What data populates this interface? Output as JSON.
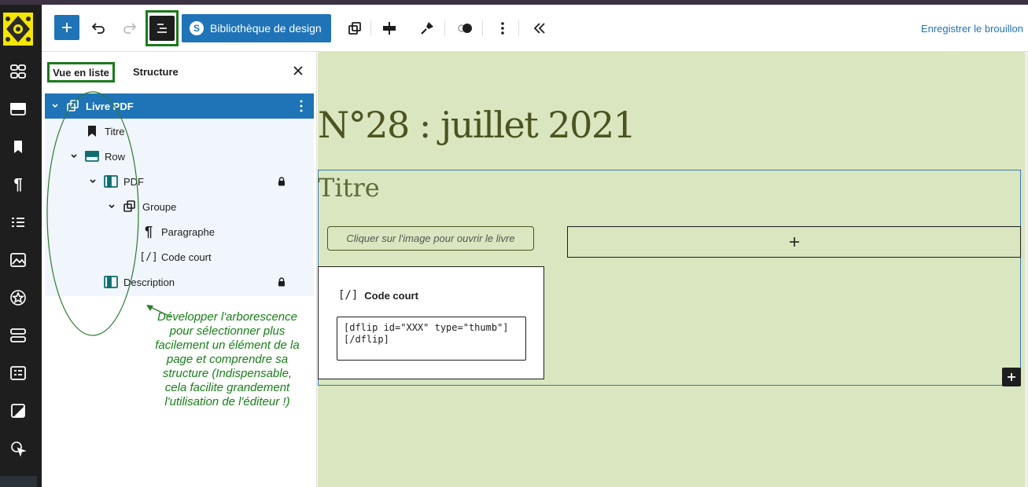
{
  "admin_menu": {
    "items": [
      "logo-icon",
      "layout-icon",
      "block-icon",
      "bookmark-icon",
      "pilcrow-icon",
      "list-icon",
      "image-icon",
      "star-icon",
      "stack-icon",
      "form-icon",
      "media-icon",
      "cursor-icon"
    ]
  },
  "toolbar": {
    "design_library_label": "Bibliothèque de design",
    "design_library_badge": "S",
    "save_draft_label": "Enregistrer le brouillon"
  },
  "panel": {
    "tabs": [
      {
        "label": "Vue en liste",
        "active": true
      },
      {
        "label": "Structure",
        "active": false
      }
    ],
    "tree": [
      {
        "label": "Livre PDF",
        "level": 0,
        "expanded": true,
        "selected": true,
        "locked": false,
        "icon": "group-icon"
      },
      {
        "label": "Titre",
        "level": 1,
        "expanded": null,
        "selected": false,
        "locked": false,
        "icon": "bookmark-icon"
      },
      {
        "label": "Row",
        "level": 1,
        "expanded": true,
        "selected": false,
        "locked": false,
        "icon": "row-icon"
      },
      {
        "label": "PDF",
        "level": 2,
        "expanded": true,
        "selected": false,
        "locked": true,
        "icon": "column-icon"
      },
      {
        "label": "Groupe",
        "level": 3,
        "expanded": true,
        "selected": false,
        "locked": false,
        "icon": "group-icon"
      },
      {
        "label": "Paragraphe",
        "level": 4,
        "expanded": null,
        "selected": false,
        "locked": false,
        "icon": "pilcrow-icon"
      },
      {
        "label": "Code court",
        "level": 4,
        "expanded": null,
        "selected": false,
        "locked": false,
        "icon": "shortcode-icon"
      },
      {
        "label": "Description",
        "level": 2,
        "expanded": null,
        "selected": false,
        "locked": true,
        "icon": "column-icon"
      }
    ]
  },
  "annotation": {
    "text": "Développer l'arborescence pour sélectionner plus facilement un élément de la page et comprendre sa structure (Indispensable, cela facilite grandement l'utilisation de l'éditeur !)"
  },
  "canvas": {
    "heading": "N°28 : juillet 2021",
    "title": "Titre",
    "pill_text": "Cliquer sur l'image pour ouvrir le livre",
    "shortcode_icon": "[/]",
    "shortcode_label": "Code court",
    "shortcode_value": "[dflip id=\"XXX\" type=\"thumb\"]\n[/dflip]"
  },
  "colors": {
    "accent": "#1f73b7",
    "canvas_bg": "#d9e6bf",
    "annotation_green": "#1b7f1b",
    "heading_olive": "#4b5320"
  }
}
